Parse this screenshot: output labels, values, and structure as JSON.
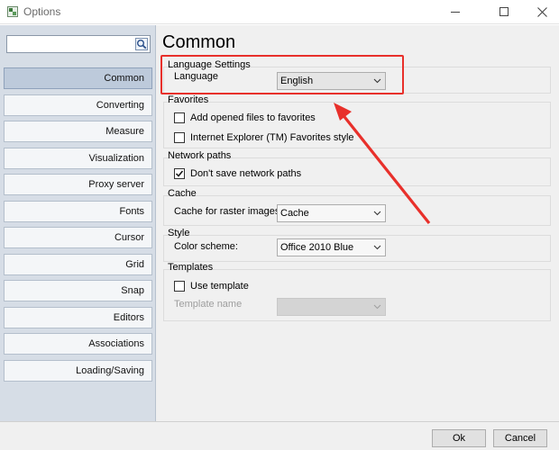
{
  "window": {
    "title": "Options"
  },
  "sidebar": {
    "search": {
      "value": "",
      "placeholder": ""
    },
    "items": [
      {
        "label": "Common",
        "selected": true
      },
      {
        "label": "Converting"
      },
      {
        "label": "Measure"
      },
      {
        "label": "Visualization"
      },
      {
        "label": "Proxy server"
      },
      {
        "label": "Fonts"
      },
      {
        "label": "Cursor"
      },
      {
        "label": "Grid"
      },
      {
        "label": "Snap"
      },
      {
        "label": "Editors"
      },
      {
        "label": "Associations"
      },
      {
        "label": "Loading/Saving"
      }
    ]
  },
  "main": {
    "title": "Common",
    "language_settings": {
      "title": "Language Settings",
      "language_label": "Language",
      "language_value": "English"
    },
    "favorites": {
      "title": "Favorites",
      "add_opened_label": "Add opened files to favorites",
      "add_opened_checked": false,
      "ie_style_label": "Internet Explorer (TM) Favorites style",
      "ie_style_checked": false
    },
    "network_paths": {
      "title": "Network paths",
      "dont_save_label": "Don't save network paths",
      "dont_save_checked": true
    },
    "cache": {
      "title": "Cache",
      "raster_label": "Cache for raster images:",
      "raster_value": "Cache"
    },
    "style": {
      "title": "Style",
      "scheme_label": "Color scheme:",
      "scheme_value": "Office 2010 Blue"
    },
    "templates": {
      "title": "Templates",
      "use_template_label": "Use template",
      "use_template_checked": false,
      "template_name_label": "Template name",
      "template_name_value": ""
    }
  },
  "footer": {
    "ok_label": "Ok",
    "cancel_label": "Cancel"
  },
  "colors": {
    "annotation": "#e8302b",
    "sidebar_bg": "#d6dde6",
    "selected_item": "#bdcadb"
  }
}
